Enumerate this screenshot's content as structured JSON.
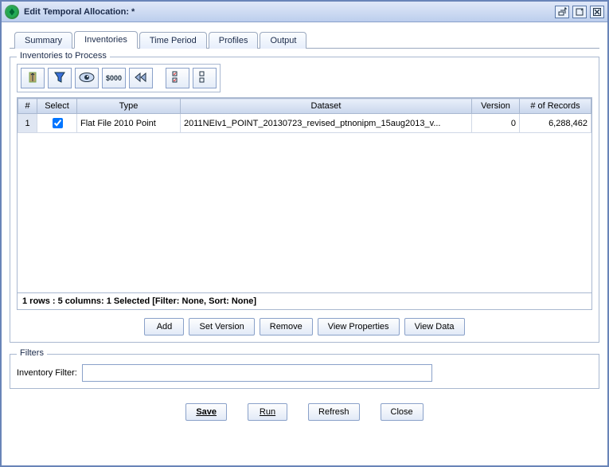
{
  "window": {
    "title": "Edit Temporal Allocation:  *"
  },
  "tabs": {
    "summary": "Summary",
    "inventories": "Inventories",
    "time_period": "Time Period",
    "profiles": "Profiles",
    "output": "Output"
  },
  "group_inventories_legend": "Inventories to Process",
  "toolbar": {
    "sort_icon": "sort",
    "filter_icon": "filter",
    "view_icon": "view",
    "format_icon": "format",
    "reset_icon": "reset",
    "select_all_icon": "select-all",
    "clear_all_icon": "clear-all",
    "format_label": "$000"
  },
  "table": {
    "headers": {
      "num": "#",
      "select": "Select",
      "type": "Type",
      "dataset": "Dataset",
      "version": "Version",
      "records": "# of Records"
    },
    "rows": [
      {
        "num": "1",
        "selected": true,
        "type": "Flat File 2010 Point",
        "dataset": "2011NEIv1_POINT_20130723_revised_ptnonipm_15aug2013_v...",
        "version": "0",
        "records": "6,288,462"
      }
    ]
  },
  "status_text": "1 rows : 5 columns: 1 Selected [Filter: None, Sort: None]",
  "actions": {
    "add": "Add",
    "set_version": "Set Version",
    "remove": "Remove",
    "view_properties": "View Properties",
    "view_data": "View Data"
  },
  "filters": {
    "legend": "Filters",
    "inventory_filter_label": "Inventory Filter:",
    "inventory_filter_value": ""
  },
  "footer": {
    "save": "Save",
    "run": "Run",
    "refresh": "Refresh",
    "close": "Close"
  }
}
